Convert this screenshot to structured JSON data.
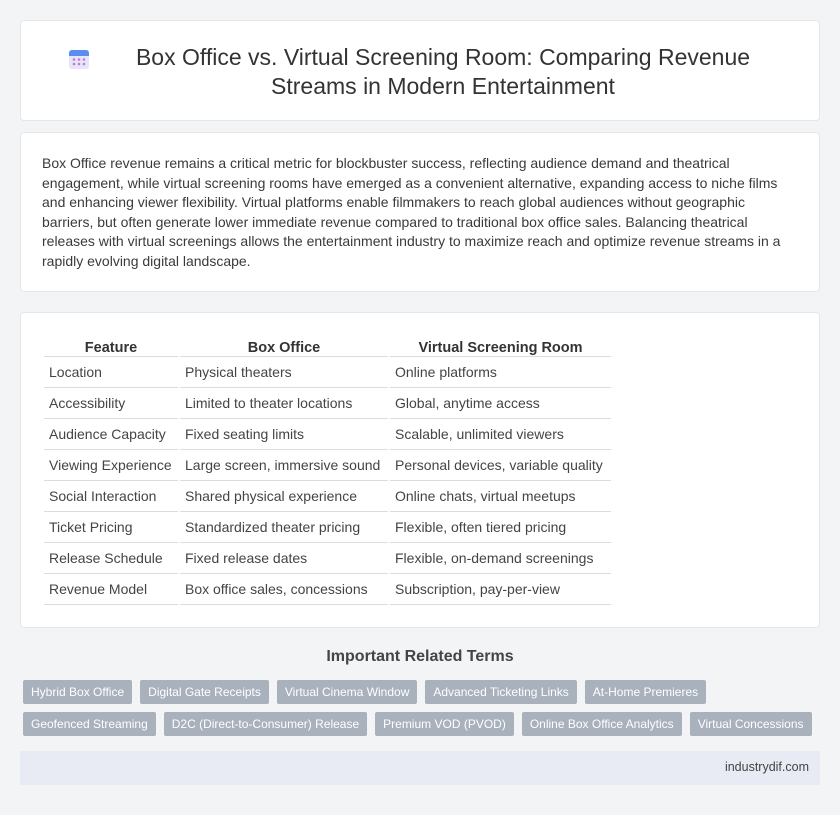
{
  "header": {
    "title": "Box Office vs. Virtual Screening Room: Comparing Revenue Streams in Modern Entertainment",
    "icon": "calendar-icon"
  },
  "intro": {
    "text": "Box Office revenue remains a critical metric for blockbuster success, reflecting audience demand and theatrical engagement, while virtual screening rooms have emerged as a convenient alternative, expanding access to niche films and enhancing viewer flexibility. Virtual platforms enable filmmakers to reach global audiences without geographic barriers, but often generate lower immediate revenue compared to traditional box office sales. Balancing theatrical releases with virtual screenings allows the entertainment industry to maximize reach and optimize revenue streams in a rapidly evolving digital landscape."
  },
  "table": {
    "headers": [
      "Feature",
      "Box Office",
      "Virtual Screening Room"
    ],
    "rows": [
      [
        "Location",
        "Physical theaters",
        "Online platforms"
      ],
      [
        "Accessibility",
        "Limited to theater locations",
        "Global, anytime access"
      ],
      [
        "Audience Capacity",
        "Fixed seating limits",
        "Scalable, unlimited viewers"
      ],
      [
        "Viewing Experience",
        "Large screen, immersive sound",
        "Personal devices, variable quality"
      ],
      [
        "Social Interaction",
        "Shared physical experience",
        "Online chats, virtual meetups"
      ],
      [
        "Ticket Pricing",
        "Standardized theater pricing",
        "Flexible, often tiered pricing"
      ],
      [
        "Release Schedule",
        "Fixed release dates",
        "Flexible, on-demand screenings"
      ],
      [
        "Revenue Model",
        "Box office sales, concessions",
        "Subscription, pay-per-view"
      ]
    ]
  },
  "related": {
    "heading": "Important Related Terms",
    "row1": [
      "Hybrid Box Office",
      "Digital Gate Receipts",
      "Virtual Cinema Window",
      "Advanced Ticketing Links",
      "At-Home Premieres"
    ],
    "row2": [
      "Geofenced Streaming",
      "D2C (Direct-to-Consumer) Release",
      "Premium VOD (PVOD)",
      "Online Box Office Analytics",
      "Virtual Concessions"
    ]
  },
  "footer": {
    "text": "industrydif.com"
  },
  "colors": {
    "tag_bg": "#a9b1bd",
    "footer_bg": "#e8ebf3",
    "page_bg": "#f3f4f6"
  }
}
